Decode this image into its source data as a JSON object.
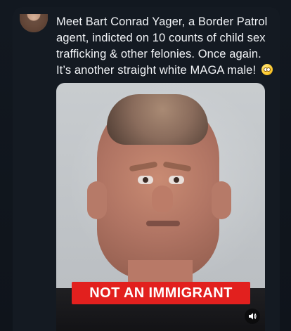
{
  "post": {
    "text": "Meet Bart Conrad Yager, a Border Patrol agent, indicted on 10 counts of child sex trafficking & other felonies. Once again. It’s another straight white MAGA male!",
    "emoji": "flushed-face-emoji"
  },
  "media": {
    "banner_text": "NOT AN IMMIGRANT",
    "sound_icon": "speaker-icon"
  },
  "colors": {
    "background": "#0f141b",
    "card": "#141a22",
    "text": "#f2f4f7",
    "banner": "#e2201e"
  }
}
